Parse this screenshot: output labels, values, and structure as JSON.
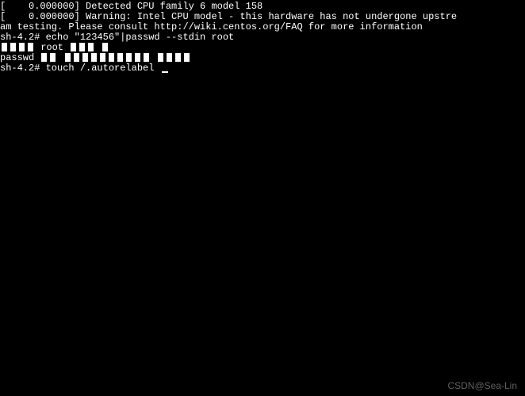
{
  "terminal": {
    "lines": [
      "[    0.000000] Detected CPU family 6 model 158",
      "[    0.000000] Warning: Intel CPU model - this hardware has not undergone upstre",
      "am testing. Please consult http://wiki.centos.org/FAQ for more information"
    ],
    "prompt1_prefix": "sh-4.2# ",
    "prompt1_cmd": "echo \"123456\"|passwd --stdin root",
    "garbled1_prefix": "",
    "garbled1_text": " root ",
    "garbled2_prefix": "passwd",
    "prompt2_prefix": "sh-4.2# ",
    "prompt2_cmd": "touch /.autorelabel ",
    "watermark": "CSDN@Sea-Lin"
  }
}
